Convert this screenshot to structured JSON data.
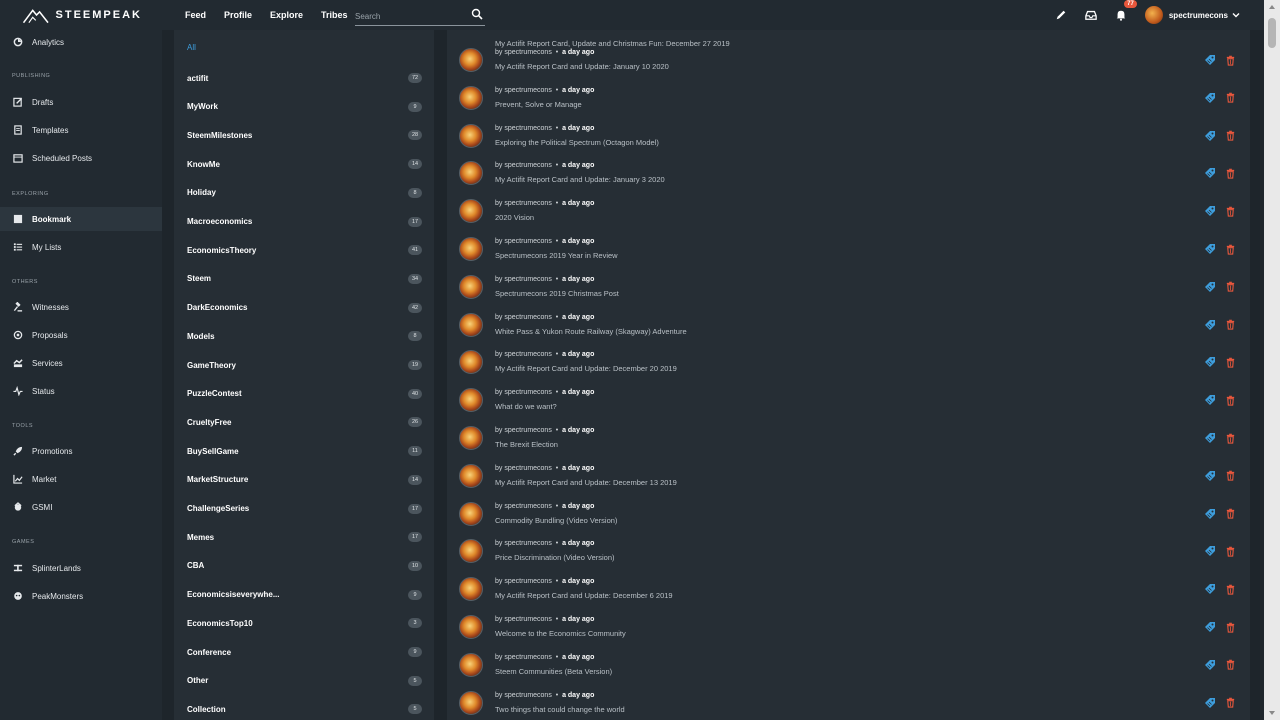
{
  "header": {
    "logo_text": "STEEMPEAK",
    "nav": [
      "Feed",
      "Profile",
      "Explore",
      "Tribes"
    ],
    "search_placeholder": "Search",
    "notifications_count": "77",
    "username": "spectrumecons"
  },
  "sidebar": {
    "items": [
      {
        "label": "Analytics",
        "icon": "analytics-icon"
      },
      {
        "label": "Drafts",
        "icon": "drafts-icon"
      },
      {
        "label": "Templates",
        "icon": "templates-icon"
      },
      {
        "label": "Scheduled Posts",
        "icon": "calendar-icon"
      },
      {
        "label": "Bookmark",
        "icon": "bookmark-icon"
      },
      {
        "label": "My Lists",
        "icon": "list-icon"
      },
      {
        "label": "Witnesses",
        "icon": "gavel-icon"
      },
      {
        "label": "Proposals",
        "icon": "proposals-icon"
      },
      {
        "label": "Services",
        "icon": "services-icon"
      },
      {
        "label": "Status",
        "icon": "pulse-icon"
      },
      {
        "label": "Promotions",
        "icon": "rocket-icon"
      },
      {
        "label": "Market",
        "icon": "chart-icon"
      },
      {
        "label": "GSMI",
        "icon": "gsmi-icon"
      },
      {
        "label": "SplinterLands",
        "icon": "splinterlands-icon"
      },
      {
        "label": "PeakMonsters",
        "icon": "peakmonsters-icon"
      }
    ],
    "sections": [
      "PUBLISHING",
      "EXPLORING",
      "OTHERS",
      "TOOLS",
      "GAMES"
    ],
    "active": "Bookmark"
  },
  "tags": {
    "all_label": "All",
    "items": [
      {
        "name": "actifit",
        "count": "72"
      },
      {
        "name": "MyWork",
        "count": "9"
      },
      {
        "name": "SteemMilestones",
        "count": "28"
      },
      {
        "name": "KnowMe",
        "count": "14"
      },
      {
        "name": "Holiday",
        "count": "8"
      },
      {
        "name": "Macroeconomics",
        "count": "17"
      },
      {
        "name": "EconomicsTheory",
        "count": "41"
      },
      {
        "name": "Steem",
        "count": "34"
      },
      {
        "name": "DarkEconomics",
        "count": "42"
      },
      {
        "name": "Models",
        "count": "8"
      },
      {
        "name": "GameTheory",
        "count": "19"
      },
      {
        "name": "PuzzleContest",
        "count": "40"
      },
      {
        "name": "CrueltyFree",
        "count": "26"
      },
      {
        "name": "BuySellGame",
        "count": "11"
      },
      {
        "name": "MarketStructure",
        "count": "14"
      },
      {
        "name": "ChallengeSeries",
        "count": "17"
      },
      {
        "name": "Memes",
        "count": "17"
      },
      {
        "name": "CBA",
        "count": "10"
      },
      {
        "name": "Economicsiseverywhe...",
        "count": "9"
      },
      {
        "name": "EconomicsTop10",
        "count": "3"
      },
      {
        "name": "Conference",
        "count": "9"
      },
      {
        "name": "Other",
        "count": "5"
      },
      {
        "name": "Collection",
        "count": "5"
      }
    ]
  },
  "posts": {
    "top_partial_title": "My Actifit Report Card, Update and Christmas Fun: December 27 2019",
    "author_prefix": "by",
    "author": "spectrumecons",
    "separator": "•",
    "time": "a day ago",
    "items": [
      "My Actifit Report Card and Update: January 10 2020",
      "Prevent, Solve or Manage",
      "Exploring the Political Spectrum (Octagon Model)",
      "My Actifit Report Card and Update: January 3 2020",
      "2020 Vision",
      "Spectrumecons 2019 Year in Review",
      "Spectrumecons 2019 Christmas Post",
      "White Pass & Yukon Route Railway (Skagway) Adventure",
      "My Actifit Report Card and Update: December 20 2019",
      "What do we want?",
      "The Brexit Election",
      "My Actifit Report Card and Update: December 13 2019",
      "Commodity Bundling (Video Version)",
      "Price Discrimination (Video Version)",
      "My Actifit Report Card and Update: December 6 2019",
      "Welcome to the Economics Community",
      "Steem Communities (Beta Version)",
      "Two things that could change the world"
    ]
  },
  "colors": {
    "accent_blue": "#3d9ddc",
    "delete_red": "#e8573c",
    "badge": "#e8573c"
  }
}
